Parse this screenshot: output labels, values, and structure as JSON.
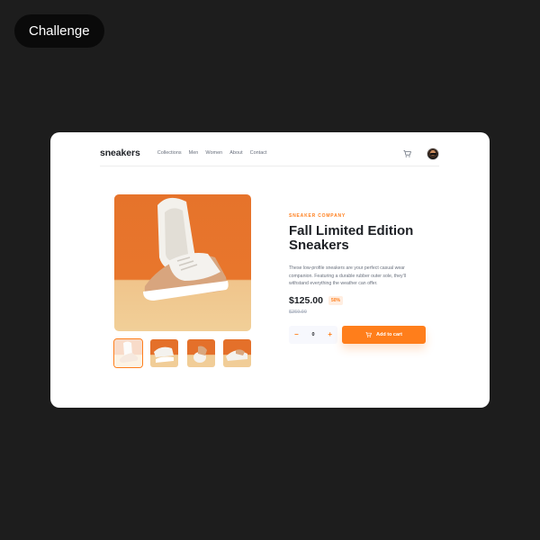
{
  "badge": {
    "label": "Challenge"
  },
  "header": {
    "logo": "sneakers",
    "nav": [
      "Collections",
      "Men",
      "Women",
      "About",
      "Contact"
    ]
  },
  "icons": {
    "cart": "cart-icon",
    "avatar": "avatar",
    "minus": "minus-icon",
    "plus": "plus-icon"
  },
  "gallery": {
    "thumbnail_count": 4,
    "active_thumbnail": 1
  },
  "product": {
    "company": "SNEAKER COMPANY",
    "title": "Fall Limited Edition Sneakers",
    "description": "These low-profile sneakers are your perfect casual wear companion. Featuring a durable rubber outer sole, they'll withstand everything the weather can offer.",
    "price": "$125.00",
    "discount": "50%",
    "old_price": "$250.00",
    "quantity": "0",
    "add_to_cart": "Add to cart"
  },
  "colors": {
    "accent": "#ff7e1b",
    "accent_pale": "#ffede0",
    "dark_text": "#1d2025",
    "grey_text": "#69707d",
    "background": "#1d1d1d"
  }
}
